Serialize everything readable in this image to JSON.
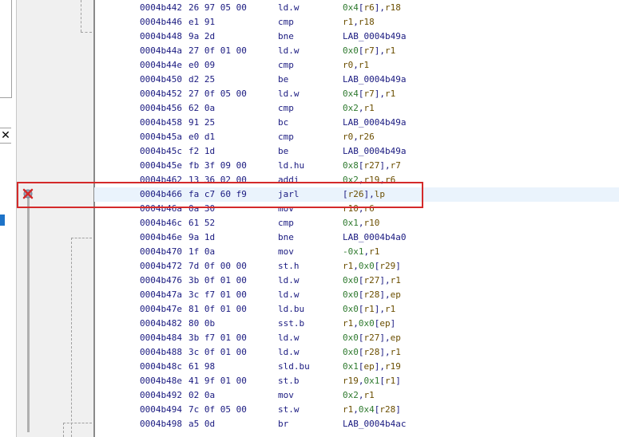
{
  "left_panel": {
    "close_label": "✕"
  },
  "breakpoint": {
    "icon": "breakpoint-disabled-icon"
  },
  "colors": {
    "highlight_border": "#d42a2a",
    "current_line_bg": "#eaf3fc",
    "address": "#1a1a80",
    "register": "#6b4e00",
    "number": "#2f7a2f"
  },
  "listing": [
    {
      "addr": "0004b442",
      "bytes": "26 97 05 00",
      "mnem": "ld.w",
      "ops": [
        [
          "n",
          "0x4"
        ],
        [
          "p",
          "["
        ],
        [
          "r",
          "r6"
        ],
        [
          "p",
          "],"
        ],
        [
          "r",
          "r18"
        ]
      ]
    },
    {
      "addr": "0004b446",
      "bytes": "e1 91",
      "mnem": "cmp",
      "ops": [
        [
          "r",
          "r1"
        ],
        [
          "p",
          ","
        ],
        [
          "r",
          "r18"
        ]
      ]
    },
    {
      "addr": "0004b448",
      "bytes": "9a 2d",
      "mnem": "bne",
      "ops": [
        [
          "l",
          "LAB_0004b49a"
        ]
      ]
    },
    {
      "addr": "0004b44a",
      "bytes": "27 0f 01 00",
      "mnem": "ld.w",
      "ops": [
        [
          "n",
          "0x0"
        ],
        [
          "p",
          "["
        ],
        [
          "r",
          "r7"
        ],
        [
          "p",
          "],"
        ],
        [
          "r",
          "r1"
        ]
      ]
    },
    {
      "addr": "0004b44e",
      "bytes": "e0 09",
      "mnem": "cmp",
      "ops": [
        [
          "r",
          "r0"
        ],
        [
          "p",
          ","
        ],
        [
          "r",
          "r1"
        ]
      ]
    },
    {
      "addr": "0004b450",
      "bytes": "d2 25",
      "mnem": "be",
      "ops": [
        [
          "l",
          "LAB_0004b49a"
        ]
      ]
    },
    {
      "addr": "0004b452",
      "bytes": "27 0f 05 00",
      "mnem": "ld.w",
      "ops": [
        [
          "n",
          "0x4"
        ],
        [
          "p",
          "["
        ],
        [
          "r",
          "r7"
        ],
        [
          "p",
          "],"
        ],
        [
          "r",
          "r1"
        ]
      ]
    },
    {
      "addr": "0004b456",
      "bytes": "62 0a",
      "mnem": "cmp",
      "ops": [
        [
          "n",
          "0x2"
        ],
        [
          "p",
          ","
        ],
        [
          "r",
          "r1"
        ]
      ]
    },
    {
      "addr": "0004b458",
      "bytes": "91 25",
      "mnem": "bc",
      "ops": [
        [
          "l",
          "LAB_0004b49a"
        ]
      ]
    },
    {
      "addr": "0004b45a",
      "bytes": "e0 d1",
      "mnem": "cmp",
      "ops": [
        [
          "r",
          "r0"
        ],
        [
          "p",
          ","
        ],
        [
          "r",
          "r26"
        ]
      ]
    },
    {
      "addr": "0004b45c",
      "bytes": "f2 1d",
      "mnem": "be",
      "ops": [
        [
          "l",
          "LAB_0004b49a"
        ]
      ]
    },
    {
      "addr": "0004b45e",
      "bytes": "fb 3f 09 00",
      "mnem": "ld.hu",
      "ops": [
        [
          "n",
          "0x8"
        ],
        [
          "p",
          "["
        ],
        [
          "r",
          "r27"
        ],
        [
          "p",
          "],"
        ],
        [
          "r",
          "r7"
        ]
      ]
    },
    {
      "addr": "0004b462",
      "bytes": "13 36 02 00",
      "mnem": "addi",
      "ops": [
        [
          "n",
          "0x2"
        ],
        [
          "p",
          ","
        ],
        [
          "r",
          "r19"
        ],
        [
          "p",
          ","
        ],
        [
          "r",
          "r6"
        ]
      ]
    },
    {
      "addr": "0004b466",
      "bytes": "fa c7 60 f9",
      "mnem": "jarl",
      "ops": [
        [
          "p",
          "["
        ],
        [
          "r",
          "r26"
        ],
        [
          "p",
          "],"
        ],
        [
          "r",
          "lp"
        ]
      ],
      "current": true
    },
    {
      "addr": "0004b46a",
      "bytes": "0a 30",
      "mnem": "mov",
      "ops": [
        [
          "r",
          "r10"
        ],
        [
          "p",
          ","
        ],
        [
          "r",
          "r6"
        ]
      ]
    },
    {
      "addr": "0004b46c",
      "bytes": "61 52",
      "mnem": "cmp",
      "ops": [
        [
          "n",
          "0x1"
        ],
        [
          "p",
          ","
        ],
        [
          "r",
          "r10"
        ]
      ]
    },
    {
      "addr": "0004b46e",
      "bytes": "9a 1d",
      "mnem": "bne",
      "ops": [
        [
          "l",
          "LAB_0004b4a0"
        ]
      ]
    },
    {
      "addr": "0004b470",
      "bytes": "1f 0a",
      "mnem": "mov",
      "ops": [
        [
          "n",
          "-0x1"
        ],
        [
          "p",
          ","
        ],
        [
          "r",
          "r1"
        ]
      ]
    },
    {
      "addr": "0004b472",
      "bytes": "7d 0f 00 00",
      "mnem": "st.h",
      "ops": [
        [
          "r",
          "r1"
        ],
        [
          "p",
          ","
        ],
        [
          "n",
          "0x0"
        ],
        [
          "p",
          "["
        ],
        [
          "r",
          "r29"
        ],
        [
          "p",
          "]"
        ]
      ]
    },
    {
      "addr": "0004b476",
      "bytes": "3b 0f 01 00",
      "mnem": "ld.w",
      "ops": [
        [
          "n",
          "0x0"
        ],
        [
          "p",
          "["
        ],
        [
          "r",
          "r27"
        ],
        [
          "p",
          "],"
        ],
        [
          "r",
          "r1"
        ]
      ]
    },
    {
      "addr": "0004b47a",
      "bytes": "3c f7 01 00",
      "mnem": "ld.w",
      "ops": [
        [
          "n",
          "0x0"
        ],
        [
          "p",
          "["
        ],
        [
          "r",
          "r28"
        ],
        [
          "p",
          "],"
        ],
        [
          "r",
          "ep"
        ]
      ]
    },
    {
      "addr": "0004b47e",
      "bytes": "81 0f 01 00",
      "mnem": "ld.bu",
      "ops": [
        [
          "n",
          "0x0"
        ],
        [
          "p",
          "["
        ],
        [
          "r",
          "r1"
        ],
        [
          "p",
          "],"
        ],
        [
          "r",
          "r1"
        ]
      ]
    },
    {
      "addr": "0004b482",
      "bytes": "80 0b",
      "mnem": "sst.b",
      "ops": [
        [
          "r",
          "r1"
        ],
        [
          "p",
          ","
        ],
        [
          "n",
          "0x0"
        ],
        [
          "p",
          "["
        ],
        [
          "r",
          "ep"
        ],
        [
          "p",
          "]"
        ]
      ]
    },
    {
      "addr": "0004b484",
      "bytes": "3b f7 01 00",
      "mnem": "ld.w",
      "ops": [
        [
          "n",
          "0x0"
        ],
        [
          "p",
          "["
        ],
        [
          "r",
          "r27"
        ],
        [
          "p",
          "],"
        ],
        [
          "r",
          "ep"
        ]
      ]
    },
    {
      "addr": "0004b488",
      "bytes": "3c 0f 01 00",
      "mnem": "ld.w",
      "ops": [
        [
          "n",
          "0x0"
        ],
        [
          "p",
          "["
        ],
        [
          "r",
          "r28"
        ],
        [
          "p",
          "],"
        ],
        [
          "r",
          "r1"
        ]
      ]
    },
    {
      "addr": "0004b48c",
      "bytes": "61 98",
      "mnem": "sld.bu",
      "ops": [
        [
          "n",
          "0x1"
        ],
        [
          "p",
          "["
        ],
        [
          "r",
          "ep"
        ],
        [
          "p",
          "],"
        ],
        [
          "r",
          "r19"
        ]
      ]
    },
    {
      "addr": "0004b48e",
      "bytes": "41 9f 01 00",
      "mnem": "st.b",
      "ops": [
        [
          "r",
          "r19"
        ],
        [
          "p",
          ","
        ],
        [
          "n",
          "0x1"
        ],
        [
          "p",
          "["
        ],
        [
          "r",
          "r1"
        ],
        [
          "p",
          "]"
        ]
      ]
    },
    {
      "addr": "0004b492",
      "bytes": "02 0a",
      "mnem": "mov",
      "ops": [
        [
          "n",
          "0x2"
        ],
        [
          "p",
          ","
        ],
        [
          "r",
          "r1"
        ]
      ]
    },
    {
      "addr": "0004b494",
      "bytes": "7c 0f 05 00",
      "mnem": "st.w",
      "ops": [
        [
          "r",
          "r1"
        ],
        [
          "p",
          ","
        ],
        [
          "n",
          "0x4"
        ],
        [
          "p",
          "["
        ],
        [
          "r",
          "r28"
        ],
        [
          "p",
          "]"
        ]
      ]
    },
    {
      "addr": "0004b498",
      "bytes": "a5 0d",
      "mnem": "br",
      "ops": [
        [
          "l",
          "LAB_0004b4ac"
        ]
      ]
    }
  ]
}
